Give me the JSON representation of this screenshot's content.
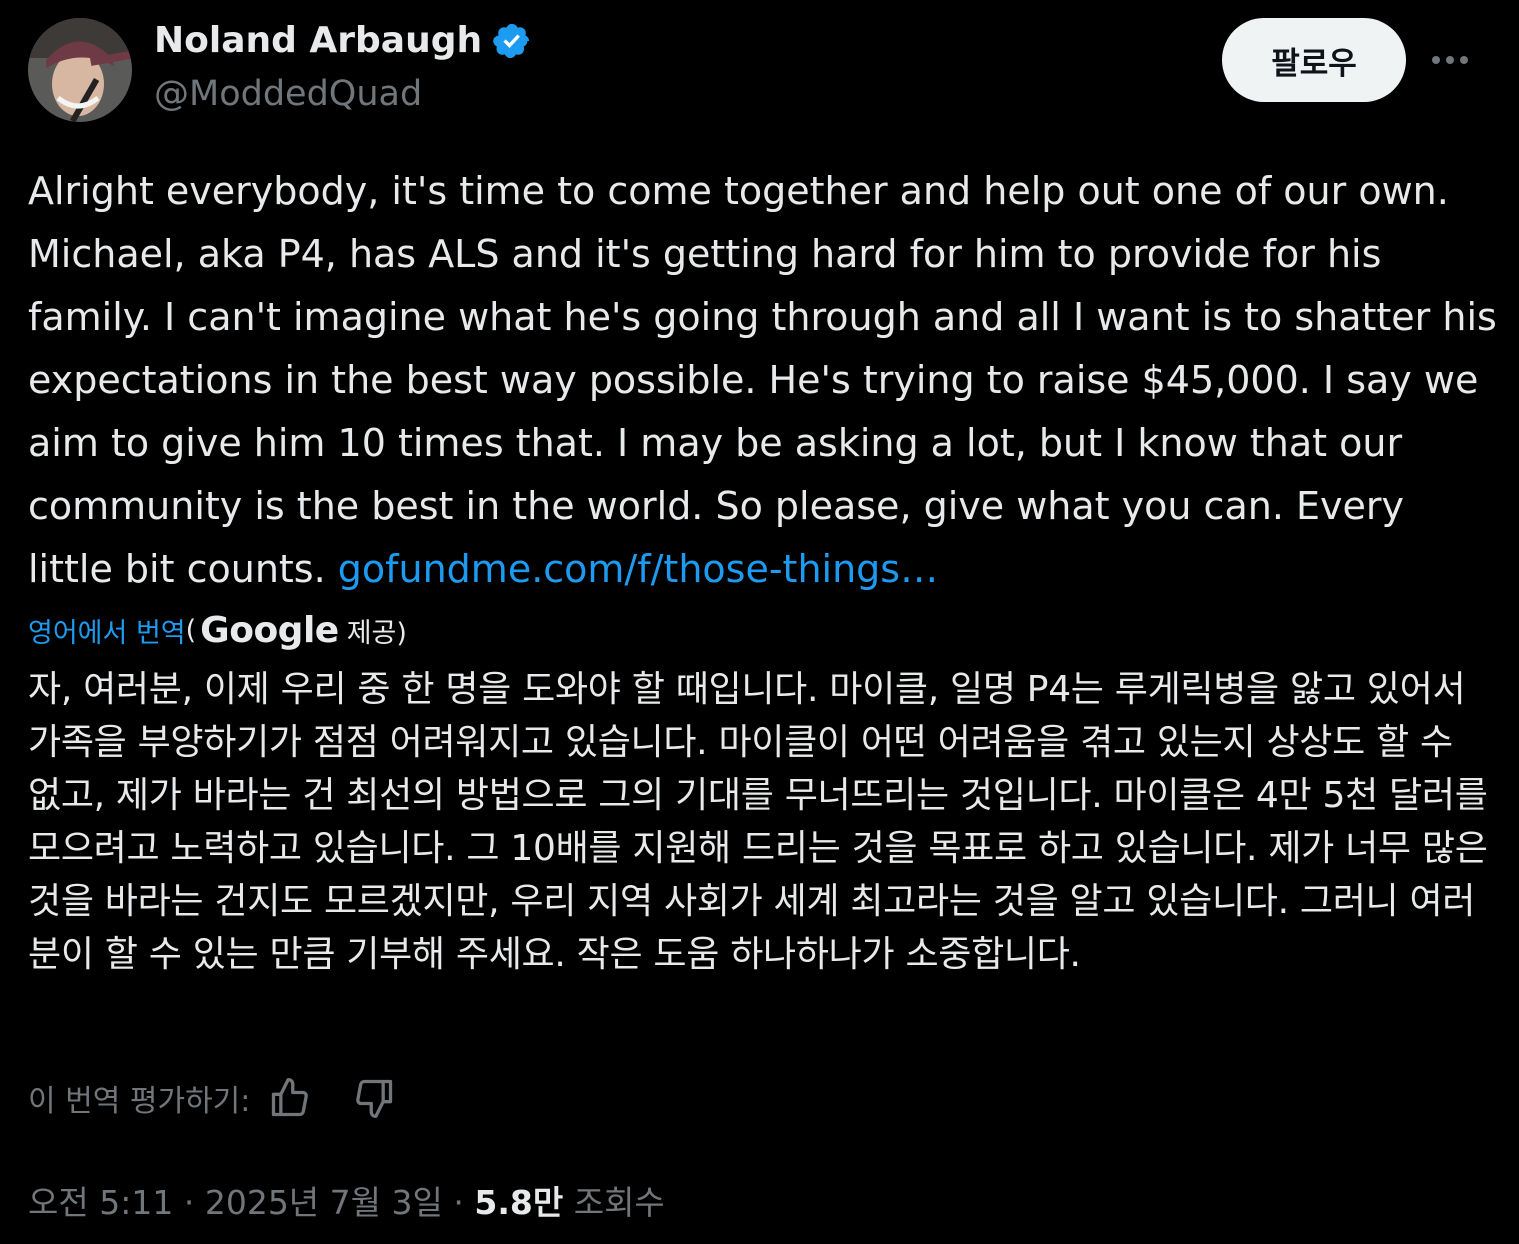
{
  "header": {
    "display_name": "Noland Arbaugh",
    "handle": "@ModdedQuad",
    "follow_label": "팔로우",
    "more_icon": "more-horizontal-icon",
    "verified_icon": "verified-badge-icon"
  },
  "tweet": {
    "text": "Alright everybody, it's time to come together and help out one of our own. Michael, aka P4, has ALS and it's getting hard for him to provide for his family. I can't imagine what he's going through and all I want is to shatter his expectations in the best way possible. He's trying to raise $45,000. I say we aim to give him 10 times that. I may be asking a lot, but I know that our community is the best in the world. So please, give what you can. Every little bit counts. ",
    "link": "gofundme.com/f/those-things…"
  },
  "translation": {
    "link_label": "영어에서 번역",
    "paren_open": "(",
    "provider": "Google",
    "provided_label": "제공)",
    "text": "자, 여러분, 이제 우리 중 한 명을 도와야 할 때입니다. 마이클, 일명 P4는 루게릭병을 앓고 있어서 가족을 부양하기가 점점 어려워지고 있습니다. 마이클이 어떤 어려움을 겪고 있는지 상상도 할 수 없고, 제가 바라는 건 최선의 방법으로 그의 기대를 무너뜨리는 것입니다. 마이클은 4만 5천 달러를 모으려고 노력하고 있습니다. 그 10배를 지원해 드리는 것을 목표로 하고 있습니다. 제가 너무 많은 것을 바라는 건지도 모르겠지만, 우리 지역 사회가 세계 최고라는 것을 알고 있습니다. 그러니 여러분이 할 수 있는 만큼 기부해 주세요. 작은 도움 하나하나가 소중합니다.",
    "rate_label": "이 번역 평가하기:",
    "thumbs_up_icon": "thumbs-up-icon",
    "thumbs_down_icon": "thumbs-down-icon"
  },
  "meta": {
    "time": "오전 5:11",
    "date": "2025년 7월 3일",
    "separator": "·",
    "views_count": "5.8만",
    "views_label": "조회수"
  },
  "colors": {
    "background": "#000000",
    "text": "#e7e9ea",
    "secondary": "#71767b",
    "link": "#1d9bf0",
    "follow_bg": "#eff3f4"
  }
}
